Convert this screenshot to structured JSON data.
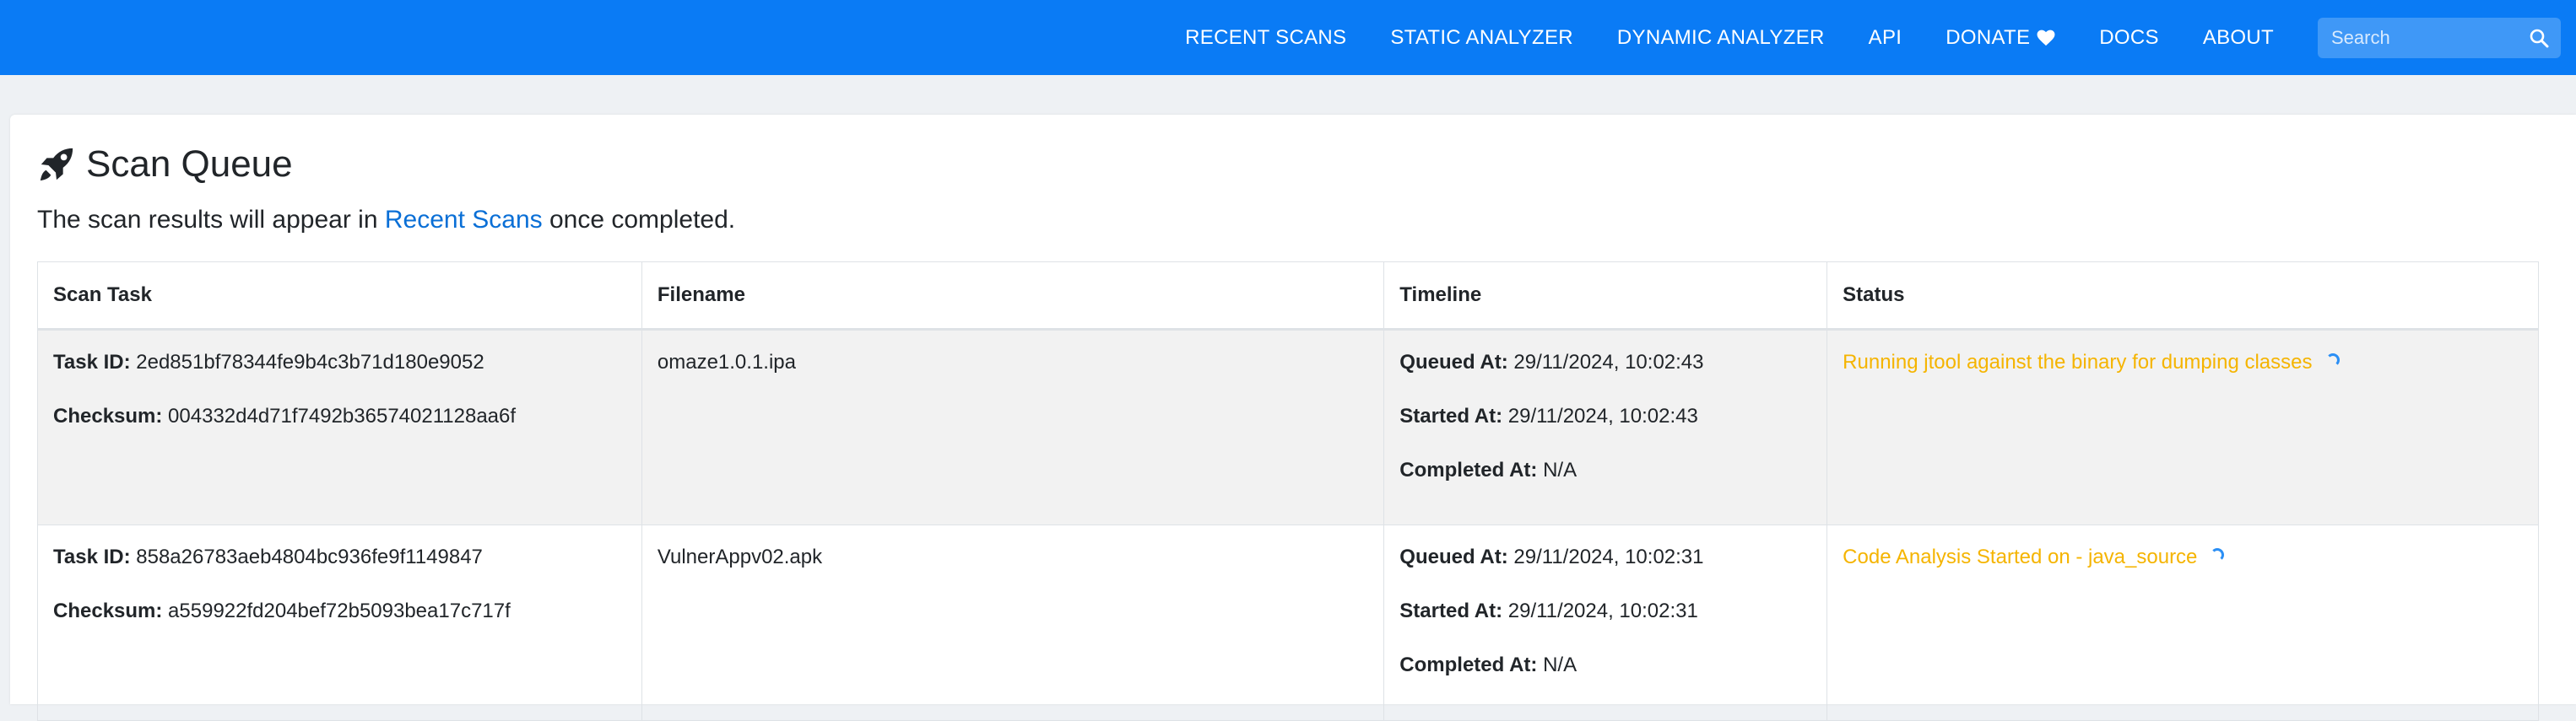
{
  "nav": {
    "items": [
      {
        "label": "RECENT SCANS"
      },
      {
        "label": "STATIC ANALYZER"
      },
      {
        "label": "DYNAMIC ANALYZER"
      },
      {
        "label": "API"
      },
      {
        "label": "DONATE"
      },
      {
        "label": "DOCS"
      },
      {
        "label": "ABOUT"
      }
    ],
    "search_placeholder": "Search"
  },
  "page": {
    "title": "Scan Queue",
    "subtitle_before": "The scan results will appear in ",
    "subtitle_link": "Recent Scans",
    "subtitle_after": " once completed."
  },
  "table": {
    "headers": [
      "Scan Task",
      "Filename",
      "Timeline",
      "Status"
    ],
    "labels": {
      "task_id": "Task ID:",
      "checksum": "Checksum:",
      "queued": "Queued At:",
      "started": "Started At:",
      "completed": "Completed At:"
    },
    "rows": [
      {
        "task_id": "2ed851bf78344fe9b4c3b71d180e9052",
        "checksum": "004332d4d71f7492b36574021128aa6f",
        "filename": "omaze1.0.1.ipa",
        "queued_at": "29/11/2024, 10:02:43",
        "started_at": "29/11/2024, 10:02:43",
        "completed_at": "N/A",
        "status": "Running jtool against the binary for dumping classes"
      },
      {
        "task_id": "858a26783aeb4804bc936fe9f1149847",
        "checksum": "a559922fd204bef72b5093bea17c717f",
        "filename": "VulnerAppv02.apk",
        "queued_at": "29/11/2024, 10:02:31",
        "started_at": "29/11/2024, 10:02:31",
        "completed_at": "N/A",
        "status": "Code Analysis Started on - java_source"
      }
    ]
  },
  "colors": {
    "navbar": "#0a7bf5",
    "link": "#0a6fd6",
    "status": "#f5b400",
    "spinner": "#2b8ff5"
  },
  "icons": {
    "title": "rocket-icon",
    "donate": "heart-icon",
    "search": "search-icon",
    "status": "spinner-icon"
  }
}
